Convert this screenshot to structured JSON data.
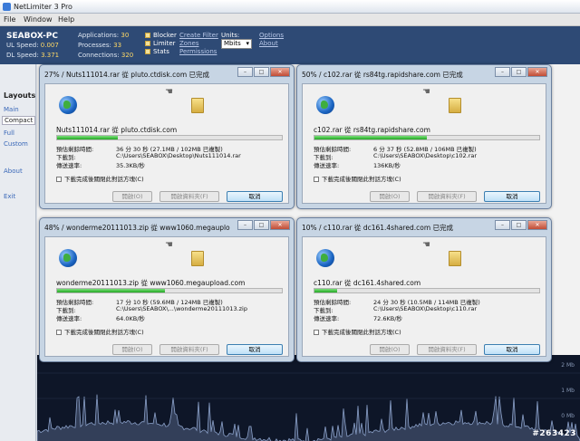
{
  "app": {
    "title": "NetLimiter 3 Pro",
    "menu": [
      "File",
      "Window",
      "Help"
    ],
    "info": {
      "pc_name": "SEABOX-PC",
      "ul_label": "UL Speed:",
      "ul_value": "0.007",
      "dl_label": "DL Speed:",
      "dl_value": "3.371",
      "apps_label": "Applications:",
      "apps_value": "30",
      "proc_label": "Processes:",
      "proc_value": "33",
      "conn_label": "Connections:",
      "conn_value": "320"
    },
    "toggles": [
      "Blocker",
      "Limiter",
      "Stats"
    ],
    "links": [
      "Create Filter",
      "Zones",
      "Permissions"
    ],
    "units_label": "Units:",
    "units_value": "Mbits",
    "right_links": [
      "Options",
      "About"
    ]
  },
  "sidebar": {
    "header": "Layouts",
    "items": [
      "Main",
      "Compact",
      "Full",
      "Custom",
      "About",
      "Exit"
    ]
  },
  "graph": {
    "labels": [
      "2 Mb",
      "1 Mb",
      "0 Mb"
    ]
  },
  "watermark": "#263423",
  "common": {
    "eta_label": "預估剩餘時間:",
    "to_label": "下載到:",
    "rate_label": "傳送速率:",
    "close_when_done": "下載完成後關閉此對話方塊(C)",
    "open_btn": "開啟(O)",
    "open_folder_btn": "開啟資料夾(F)",
    "cancel_btn": "取消"
  },
  "dialogs": [
    {
      "caption": "27% / Nuts111014.rar 從 pluto.ctdisk.com 已完成",
      "file": "Nuts111014.rar 從 pluto.ctdisk.com",
      "progress": 0.27,
      "eta": "36 分 30 秒 (27.1MB / 102MB 已複製)",
      "path": "C:\\Users\\SEABOX\\Desktop\\Nuts111014.rar",
      "rate": "35.3KB/秒"
    },
    {
      "caption": "50% / c102.rar 從 rs84tg.rapidshare.com 已完成",
      "file": "c102.rar 從 rs84tg.rapidshare.com",
      "progress": 0.5,
      "eta": "6 分 37 秒 (52.8MB / 106MB 已複製)",
      "path": "C:\\Users\\SEABOX\\Desktop\\c102.rar",
      "rate": "136KB/秒"
    },
    {
      "caption": "48% / wonderme20111013.zip 從 www1060.megauplo...",
      "file": "wonderme20111013.zip 從 www1060.megaupload.com",
      "progress": 0.48,
      "eta": "17 分 10 秒 (59.6MB / 124MB 已複製)",
      "path": "C:\\Users\\SEABOX\\...\\wonderme20111013.zip",
      "rate": "64.0KB/秒"
    },
    {
      "caption": "10% / c110.rar 從 dc161.4shared.com 已完成",
      "file": "c110.rar 從 dc161.4shared.com",
      "progress": 0.1,
      "eta": "24 分 30 秒 (10.5MB / 114MB 已複製)",
      "path": "C:\\Users\\SEABOX\\Desktop\\c110.rar",
      "rate": "72.6KB/秒"
    }
  ]
}
